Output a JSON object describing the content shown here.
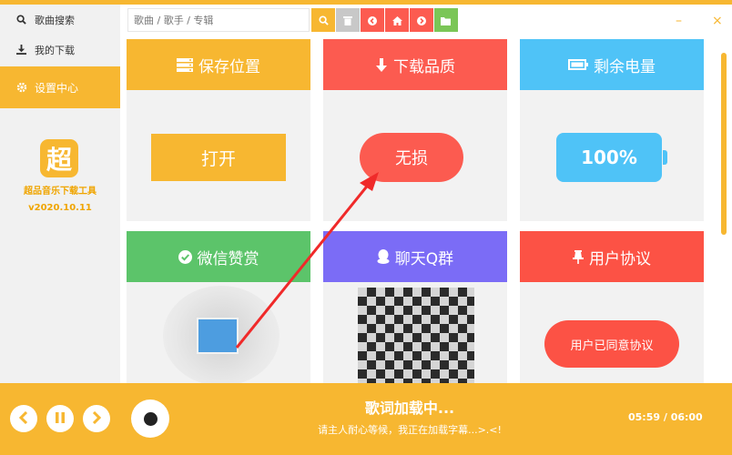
{
  "sidebar": {
    "items": [
      {
        "label": "歌曲搜索",
        "icon": "search-icon"
      },
      {
        "label": "我的下载",
        "icon": "download-icon"
      },
      {
        "label": "设置中心",
        "icon": "gear-icon"
      }
    ],
    "logo_char": "超",
    "app_name": "超品音乐下载工具",
    "version": "v2020.10.11"
  },
  "header": {
    "search_placeholder": "歌曲 / 歌手 / 专辑",
    "toolbar": [
      "search-icon",
      "trash-icon",
      "back-icon",
      "home-icon",
      "forward-icon",
      "folder-icon"
    ],
    "minimize_label": "–",
    "close_label": "×"
  },
  "cards": {
    "save_location": {
      "title": "保存位置",
      "button": "打开"
    },
    "download_quality": {
      "title": "下载品质",
      "button": "无损"
    },
    "battery": {
      "title": "剩余电量",
      "value": "100%"
    },
    "wechat": {
      "title": "微信赞赏"
    },
    "qq_group": {
      "title": "聊天Q群"
    },
    "agreement": {
      "title": "用户协议",
      "button": "用户已同意协议"
    }
  },
  "player": {
    "lyric_title": "歌词加载中...",
    "lyric_sub": "请主人耐心等候，我正在加载字幕...>.<!",
    "time": "05:59 / 06:00"
  },
  "colors": {
    "accent": "#f7b731",
    "red": "#fc5b50",
    "blue": "#4fc3f7",
    "green": "#5cc46a",
    "purple": "#7b6cf6",
    "orange_red": "#fc5245"
  }
}
